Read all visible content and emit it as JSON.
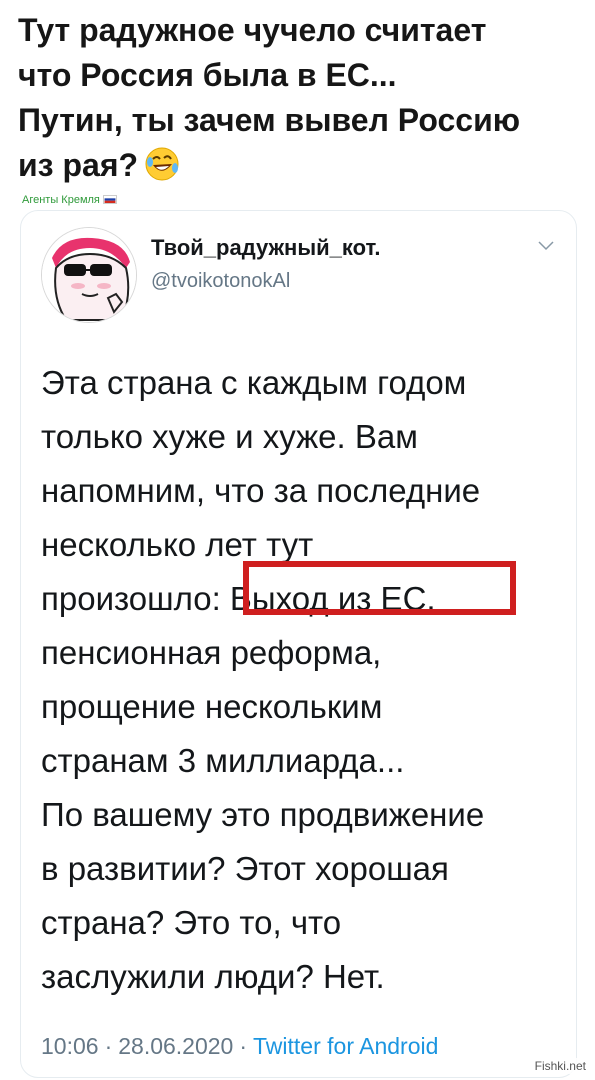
{
  "caption": {
    "lines": [
      "Тут радужное чучело считает",
      "что Россия была в ЕС...",
      "Путин, ты зачем вывел Россию",
      "из рая?"
    ],
    "emoji": "rolling-on-floor-laughing"
  },
  "source_tag": "Агенты Кремля",
  "tweet": {
    "display_name": "Твой_радужный_кот.",
    "handle": "@tvoikotonokAl",
    "text_lines": [
      "Эта страна с каждым годом",
      "только хуже и хуже. Вам",
      "напомним, что за последние",
      "несколько лет тут",
      "произошло: Выход из ЕС,",
      "пенсионная реформа,",
      "прощение нескольким",
      "странам 3 миллиарда...",
      "По вашему это продвижение",
      "в развитии? Этот хорошая",
      "страна? Это то, что",
      "заслужили люди? Нет."
    ],
    "time": "10:06",
    "date": "28.06.2020",
    "separator": "·",
    "client": "Twitter for Android",
    "highlight_color": "#cf1f1f"
  },
  "watermark": "Fishki.net",
  "colors": {
    "source_tag": "#2f9a3a",
    "muted": "#657786",
    "link": "#1b95e0"
  }
}
